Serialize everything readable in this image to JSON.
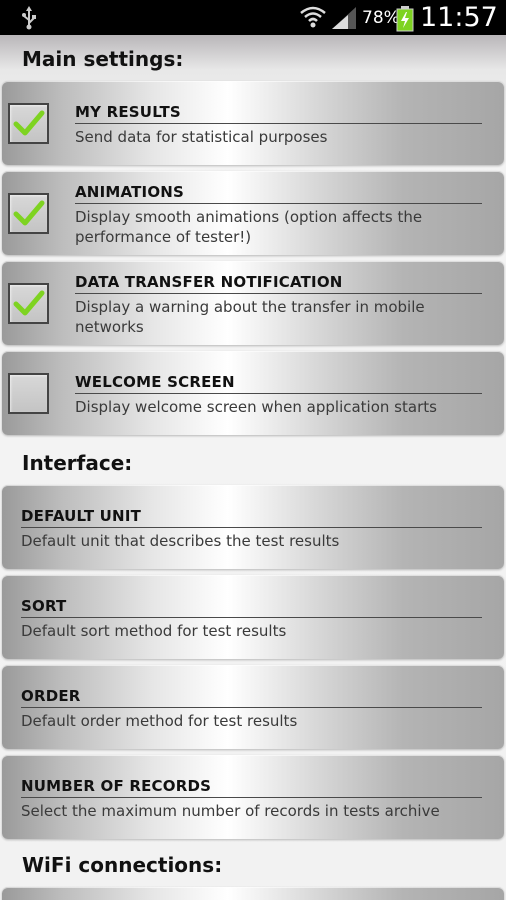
{
  "statusbar": {
    "battery_percent": "78%",
    "time": "11:57"
  },
  "sections": {
    "main": "Main settings:",
    "interface": "Interface:",
    "wifi": "WiFi connections:"
  },
  "main_items": [
    {
      "title": "MY RESULTS",
      "desc": "Send data for statistical purposes",
      "checked": true
    },
    {
      "title": "ANIMATIONS",
      "desc": "Display smooth animations (option affects the performance of tester!)",
      "checked": true
    },
    {
      "title": "DATA TRANSFER NOTIFICATION",
      "desc": "Display a warning about the transfer in mobile networks",
      "checked": true
    },
    {
      "title": "WELCOME SCREEN",
      "desc": "Display welcome screen when application starts",
      "checked": false
    }
  ],
  "interface_items": [
    {
      "title": "DEFAULT UNIT",
      "desc": "Default unit that describes the test results"
    },
    {
      "title": "SORT",
      "desc": "Default sort method for test results"
    },
    {
      "title": "ORDER",
      "desc": "Default order method for test results"
    },
    {
      "title": "NUMBER OF RECORDS",
      "desc": "Select the maximum number of records in tests archive"
    }
  ],
  "colors": {
    "check_green": "#7ed321",
    "statusbar_bg": "#000000",
    "battery_green": "#7ed321"
  }
}
